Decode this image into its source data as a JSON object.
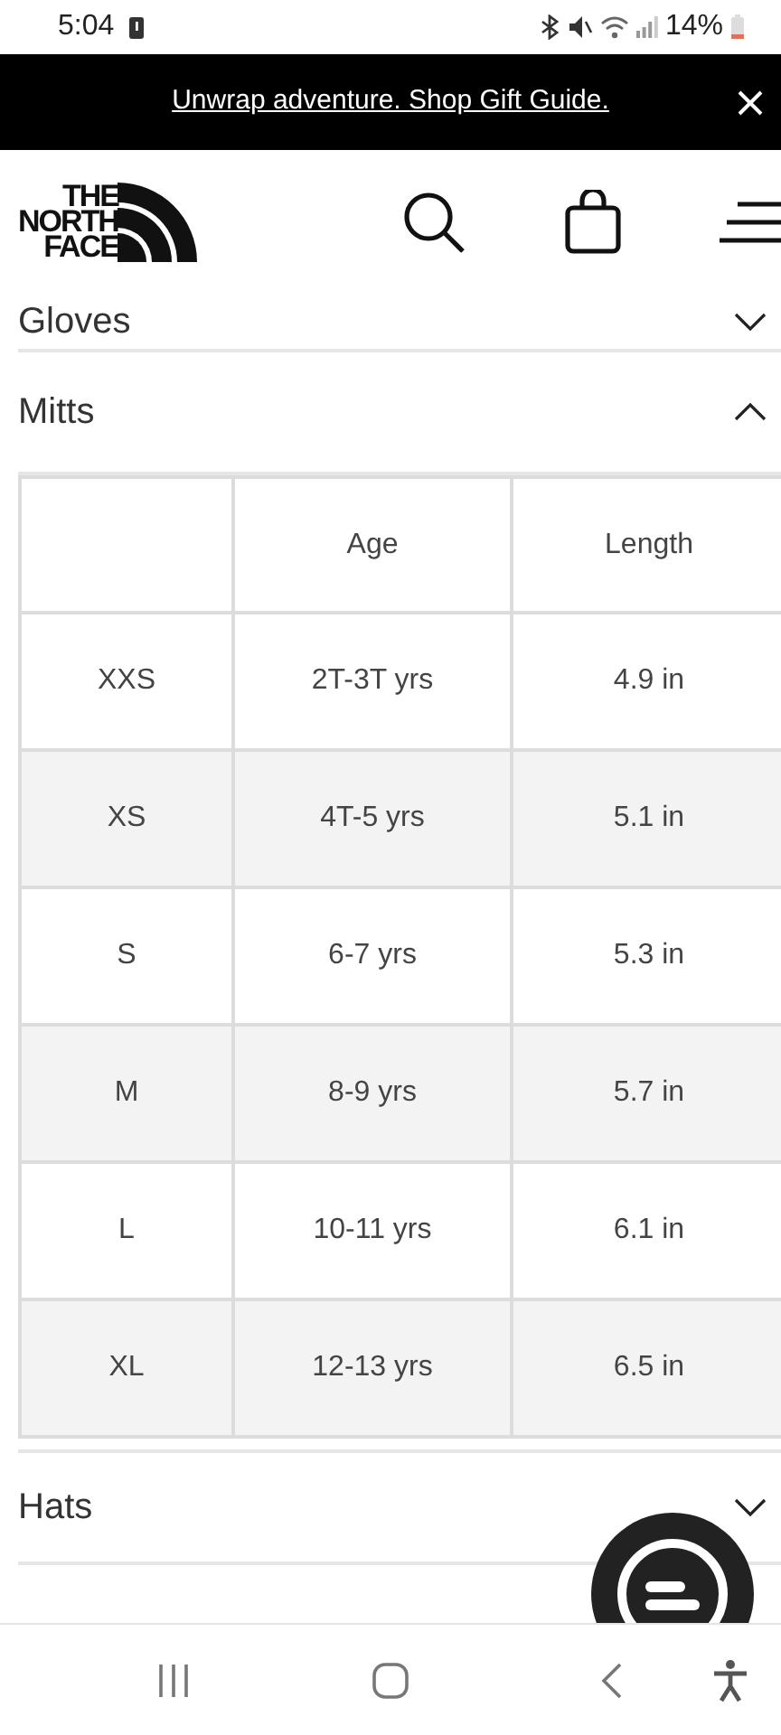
{
  "status_bar": {
    "time": "5:04",
    "battery": "14%"
  },
  "promo_banner": {
    "text": "Unwrap adventure. Shop Gift Guide."
  },
  "header": {
    "logo": [
      "THE",
      "NORTH",
      "FACE"
    ]
  },
  "sections": [
    {
      "title": "Gloves",
      "expanded": false
    },
    {
      "title": "Mitts",
      "expanded": true,
      "table": {
        "columns": [
          "",
          "Age",
          "Length"
        ],
        "rows": [
          [
            "XXS",
            "2T-3T yrs",
            "4.9 in"
          ],
          [
            "XS",
            "4T-5 yrs",
            "5.1 in"
          ],
          [
            "S",
            "6-7 yrs",
            "5.3 in"
          ],
          [
            "M",
            "8-9 yrs",
            "5.7 in"
          ],
          [
            "L",
            "10-11 yrs",
            "6.1 in"
          ],
          [
            "XL",
            "12-13 yrs",
            "6.5 in"
          ]
        ]
      }
    },
    {
      "title": "Hats",
      "expanded": false
    }
  ]
}
